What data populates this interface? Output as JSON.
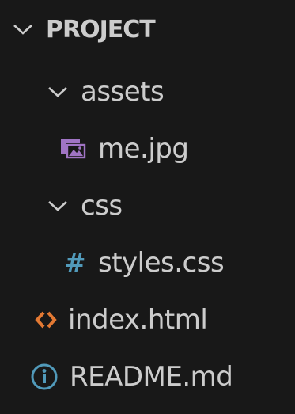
{
  "explorer": {
    "section_title": "PROJECT",
    "items": [
      {
        "label": "assets",
        "type": "folder",
        "expanded": true
      },
      {
        "label": "me.jpg",
        "type": "file",
        "icon": "image-icon"
      },
      {
        "label": "css",
        "type": "folder",
        "expanded": true
      },
      {
        "label": "styles.css",
        "type": "file",
        "icon": "css-hash-icon",
        "icon_glyph": "#"
      },
      {
        "label": "index.html",
        "type": "file",
        "icon": "html-icon"
      },
      {
        "label": "README.md",
        "type": "file",
        "icon": "info-icon"
      }
    ]
  },
  "colors": {
    "background": "#181818",
    "text": "#cccccc",
    "image_icon": "#a074c4",
    "css_icon": "#519aba",
    "html_icon": "#e37933",
    "info_icon": "#519aba"
  }
}
